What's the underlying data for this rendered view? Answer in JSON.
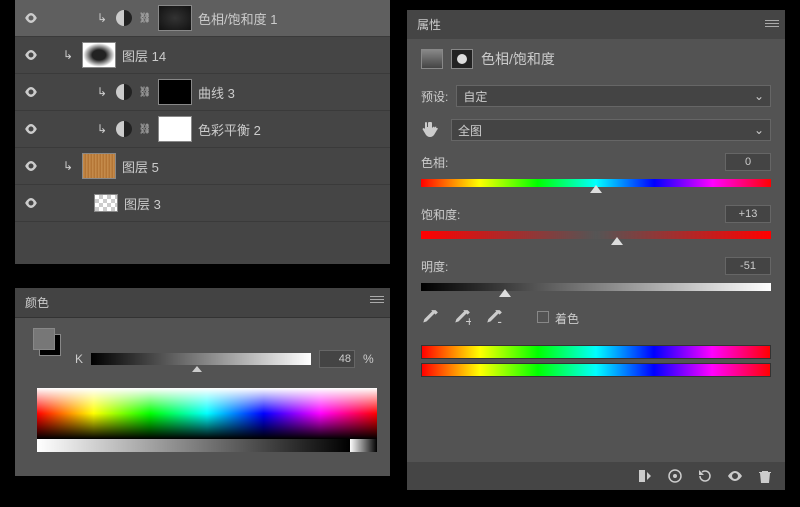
{
  "layers": [
    {
      "name": "色相/饱和度 1",
      "eye": true,
      "adj": true,
      "sel": true,
      "thumb": "dark"
    },
    {
      "name": "图层 14",
      "eye": true,
      "adj": false,
      "thumb": "smudge",
      "indent": true
    },
    {
      "name": "曲线 3",
      "eye": true,
      "adj": true,
      "thumb": "black"
    },
    {
      "name": "色彩平衡 2",
      "eye": true,
      "adj": true,
      "thumb": "white"
    },
    {
      "name": "图层 5",
      "eye": true,
      "adj": false,
      "thumb": "wood",
      "indent": true
    },
    {
      "name": "图层 3",
      "eye": true,
      "adj": false,
      "thumb": "small",
      "indent": false
    }
  ],
  "colorPanel": {
    "title": "颜色",
    "channel": "K",
    "value": "48",
    "unit": "%"
  },
  "props": {
    "title": "属性",
    "header": "色相/饱和度",
    "presetLabel": "预设:",
    "preset": "自定",
    "rangeLabel": "全图",
    "hueLabel": "色相:",
    "hue": "0",
    "satLabel": "饱和度:",
    "sat": "+13",
    "lightLabel": "明度:",
    "light": "-51",
    "colorize": "着色"
  }
}
